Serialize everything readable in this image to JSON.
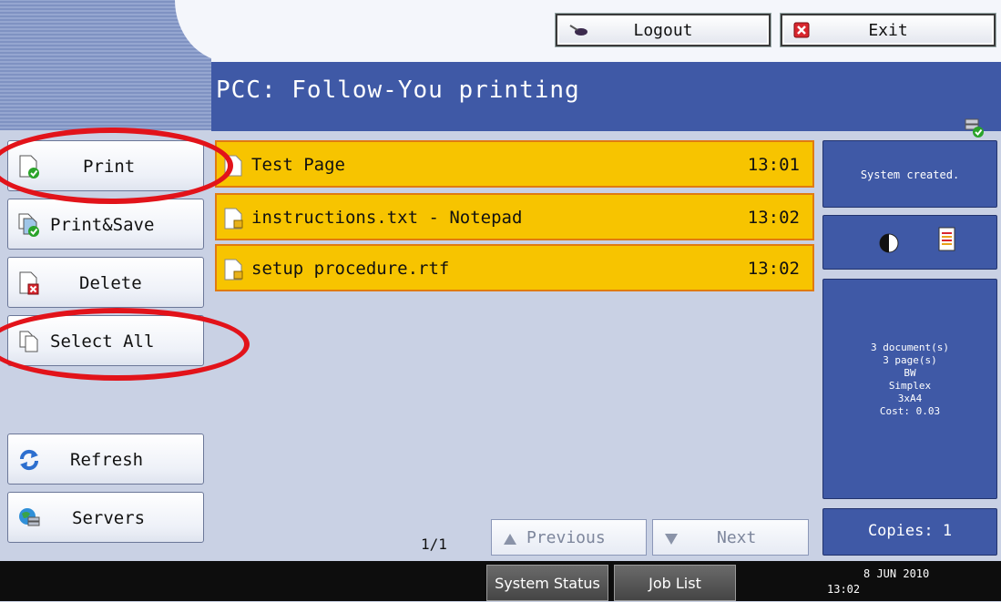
{
  "header": {
    "logout_label": "Logout",
    "exit_label": "Exit",
    "title": "PCC: Follow-You printing"
  },
  "sidebar": {
    "print": "Print",
    "print_save": "Print&Save",
    "delete": "Delete",
    "select_all": "Select All",
    "refresh": "Refresh",
    "servers": "Servers"
  },
  "jobs": [
    {
      "name": "Test Page",
      "time": "13:01"
    },
    {
      "name": "instructions.txt - Notepad",
      "time": "13:02"
    },
    {
      "name": "setup procedure.rtf",
      "time": "13:02"
    }
  ],
  "info": {
    "status": "System created.",
    "summary": [
      "3 document(s)",
      "3 page(s)",
      "BW",
      "Simplex",
      "3xA4",
      "Cost: 0.03"
    ],
    "copies": "Copies: 1"
  },
  "paging": {
    "indicator": "1/1",
    "previous": "Previous",
    "next": "Next"
  },
  "footer": {
    "system_status": "System Status",
    "job_list": "Job List",
    "date": "8 JUN  2010",
    "time": "13:02"
  },
  "colors": {
    "title_blue": "#3f59a6",
    "job_highlight": "#f7c400",
    "annotation_red": "#e2131a"
  }
}
